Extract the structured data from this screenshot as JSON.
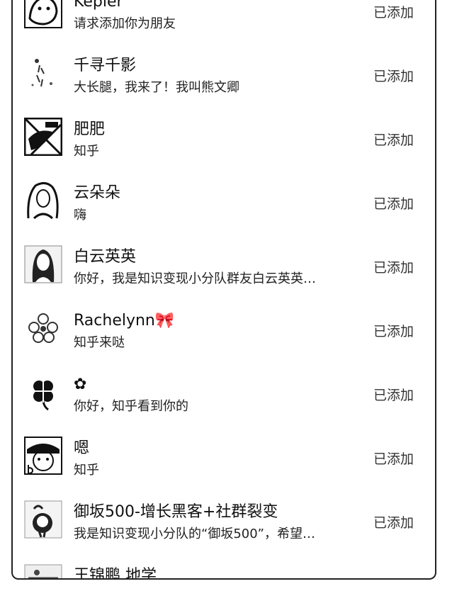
{
  "friend_requests": [
    {
      "name": "Kepler",
      "message": "请求添加你为朋友",
      "status": "已添加",
      "avatar": "sketch-face-avatar"
    },
    {
      "name": "千寻千影",
      "message": "大长腿，我来了！我叫熊文卿",
      "status": "已添加",
      "avatar": "sparse-figure-avatar"
    },
    {
      "name": "肥肥",
      "message": "知乎",
      "status": "已添加",
      "avatar": "drawing-avatar"
    },
    {
      "name": "云朵朵",
      "message": "嗨",
      "status": "已添加",
      "avatar": "woman-portrait-avatar"
    },
    {
      "name": "白云英英",
      "message": "你好，我是知识变现小分队群友白云英英…",
      "status": "已添加",
      "avatar": "woman-long-hair-avatar"
    },
    {
      "name": "Rachelynn🎀",
      "message": "知乎来哒",
      "status": "已添加",
      "avatar": "flower-avatar"
    },
    {
      "name": "✿",
      "message": "你好，知乎看到你的",
      "status": "已添加",
      "avatar": "clover-avatar"
    },
    {
      "name": "嗯",
      "message": "知乎",
      "status": "已添加",
      "avatar": "cartoon-face-avatar"
    },
    {
      "name": "御坂500-增长黑客+社群裂变",
      "message": "我是知识变现小分队的“御坂500”，希望…",
      "status": "已添加",
      "avatar": "character-avatar"
    },
    {
      "name": "王锦鹏 地学",
      "message": "",
      "status": "",
      "avatar": "photo-avatar"
    }
  ]
}
